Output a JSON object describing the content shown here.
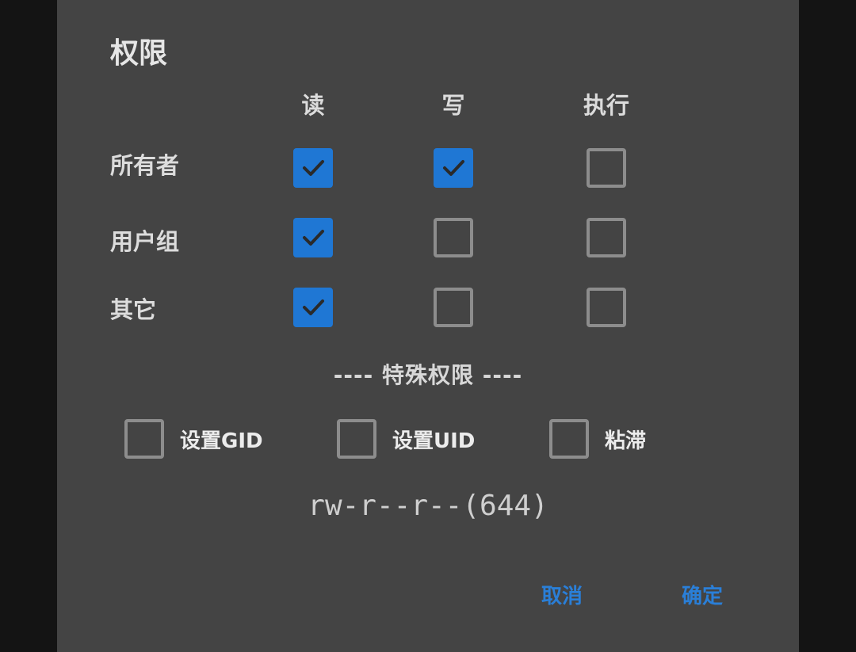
{
  "dialog": {
    "title": "权限",
    "columns": [
      "读",
      "写",
      "执行"
    ],
    "rows": [
      {
        "label": "所有者",
        "read": true,
        "write": true,
        "execute": false
      },
      {
        "label": "用户组",
        "read": true,
        "write": false,
        "execute": false
      },
      {
        "label": "其它",
        "read": true,
        "write": false,
        "execute": false
      }
    ],
    "special_header": "---- 特殊权限 ----",
    "special": [
      {
        "label": "设置GID",
        "checked": false
      },
      {
        "label": "设置UID",
        "checked": false
      },
      {
        "label": "粘滞",
        "checked": false
      }
    ],
    "mode_string": "rw-r--r--(644)",
    "cancel_label": "取消",
    "ok_label": "确定"
  },
  "colors": {
    "dialog_bg": "#444444",
    "checked": "#1f77d4",
    "unchecked_border": "#8d8d8d",
    "button_text": "#2a7fd8"
  }
}
